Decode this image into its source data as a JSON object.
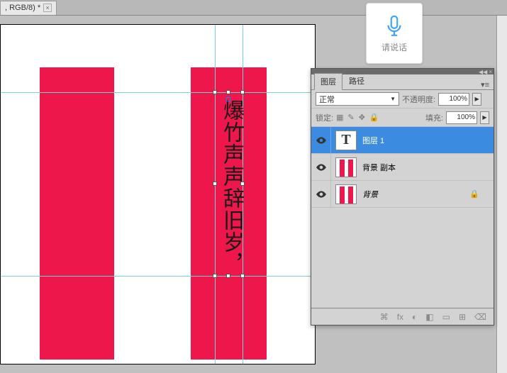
{
  "tab": {
    "label": ", RGB/8) *",
    "close": "×"
  },
  "voice": {
    "hint": "请说话"
  },
  "canvas": {
    "text": "爆竹声声辞旧岁，",
    "color_red": "#ed174b"
  },
  "panel": {
    "tabs": {
      "layers": "图层",
      "paths": "路径"
    },
    "blend": {
      "mode": "正常",
      "opacity_label": "不透明度:",
      "opacity": "100%"
    },
    "lock": {
      "label": "锁定:",
      "fill_label": "填充:",
      "fill": "100%"
    },
    "layers": [
      {
        "name": "图层 1",
        "type": "text"
      },
      {
        "name": "背景 副本",
        "type": "bars"
      },
      {
        "name": "背景",
        "type": "bars",
        "locked": true
      }
    ],
    "footer_icons": [
      "⌘",
      "fx",
      "◐",
      "◧",
      "▭",
      "⊞",
      "⌫"
    ]
  }
}
